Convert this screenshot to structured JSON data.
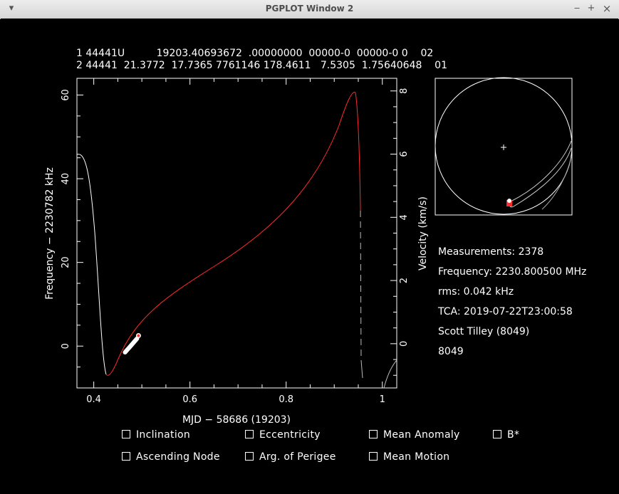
{
  "window": {
    "title": "PGPLOT Window 2",
    "minimize": "‒",
    "maximize": "+",
    "close": "×"
  },
  "tle": {
    "line1": "1 44441U          19203.40693672  .00000000  00000-0  00000-0 0    02",
    "line2": "2 44441  21.3772  17.7365 7761146 178.4611   7.5305  1.75640648    01"
  },
  "plot": {
    "x_label": "MJD − 58686 (19203)",
    "y_left_label": "Frequency − 2230782 kHz",
    "y_right_label": "Velocity (km/s)",
    "x_ticks": [
      "0.4",
      "0.6",
      "0.8",
      "1"
    ],
    "y_left_ticks": [
      "0",
      "20",
      "40",
      "60"
    ],
    "y_right_ticks": [
      "0",
      "2",
      "4",
      "6",
      "8"
    ]
  },
  "chart_data": {
    "type": "line",
    "xlabel": "MJD − 58686 (19203)",
    "ylabel": "Frequency − 2230782 kHz",
    "xlim": [
      0.365,
      1.03
    ],
    "ylim": [
      -10,
      64
    ],
    "y2lim": [
      -1.4,
      8.4
    ],
    "grid": false,
    "series": [],
    "measurements": {
      "x_range": [
        0.465,
        0.49
      ],
      "y_range": [
        -1.5,
        1.8
      ]
    },
    "highlight_point": {
      "x": 0.493,
      "y": 2.5
    }
  },
  "info": {
    "measurements": "Measurements: 2378",
    "frequency": "Frequency: 2230.800500 MHz",
    "rms": "rms: 0.042 kHz",
    "tca": "TCA: 2019-07-22T23:00:58",
    "observer": "Scott Tilley (8049)",
    "site": "8049",
    "site_color": "#ff2020"
  },
  "colors": {
    "prediction": "#ff2a2a",
    "curve": "#ffffff",
    "background": "#000000"
  },
  "checkboxes": [
    {
      "label": "Inclination"
    },
    {
      "label": "Eccentricity"
    },
    {
      "label": "Mean Anomaly"
    },
    {
      "label": "B*"
    },
    {
      "label": "Ascending Node"
    },
    {
      "label": "Arg. of Perigee"
    },
    {
      "label": "Mean Motion"
    }
  ]
}
